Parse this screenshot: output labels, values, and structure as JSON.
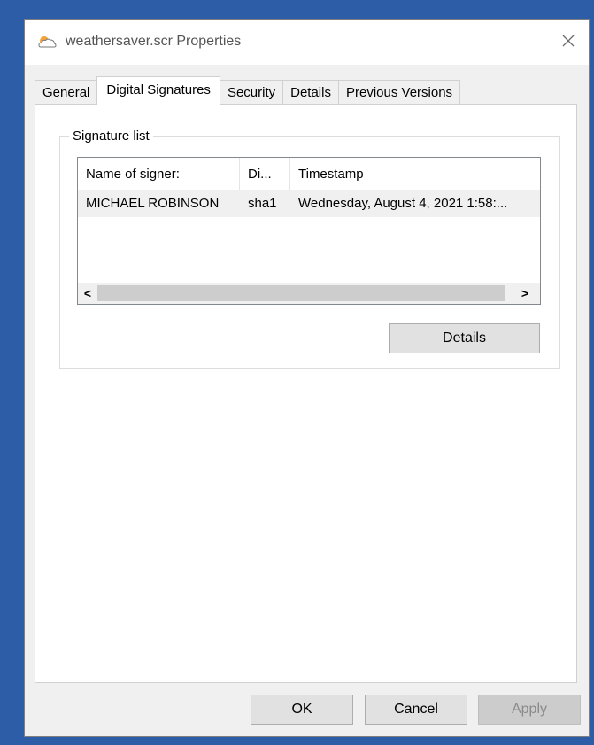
{
  "window": {
    "title": "weathersaver.scr Properties",
    "icon": "weather-cloud-sun-icon",
    "close_icon": "close-icon"
  },
  "tabs": [
    {
      "label": "General",
      "active": false
    },
    {
      "label": "Digital Signatures",
      "active": true
    },
    {
      "label": "Security",
      "active": false
    },
    {
      "label": "Details",
      "active": false
    },
    {
      "label": "Previous Versions",
      "active": false
    }
  ],
  "signature_list": {
    "group_label": "Signature list",
    "columns": [
      "Name of signer:",
      "Di...",
      "Timestamp"
    ],
    "rows": [
      {
        "name": "MICHAEL ROBINSON",
        "digest": "sha1",
        "timestamp": "Wednesday, August 4, 2021 1:58:..."
      }
    ],
    "scroll_left_glyph": "<",
    "scroll_right_glyph": ">"
  },
  "buttons": {
    "details": "Details",
    "ok": "OK",
    "cancel": "Cancel",
    "apply": "Apply"
  },
  "colors": {
    "desktop": "#2d5da6",
    "dialog_bg": "#f0f0f0",
    "button_bg": "#e1e1e1"
  }
}
